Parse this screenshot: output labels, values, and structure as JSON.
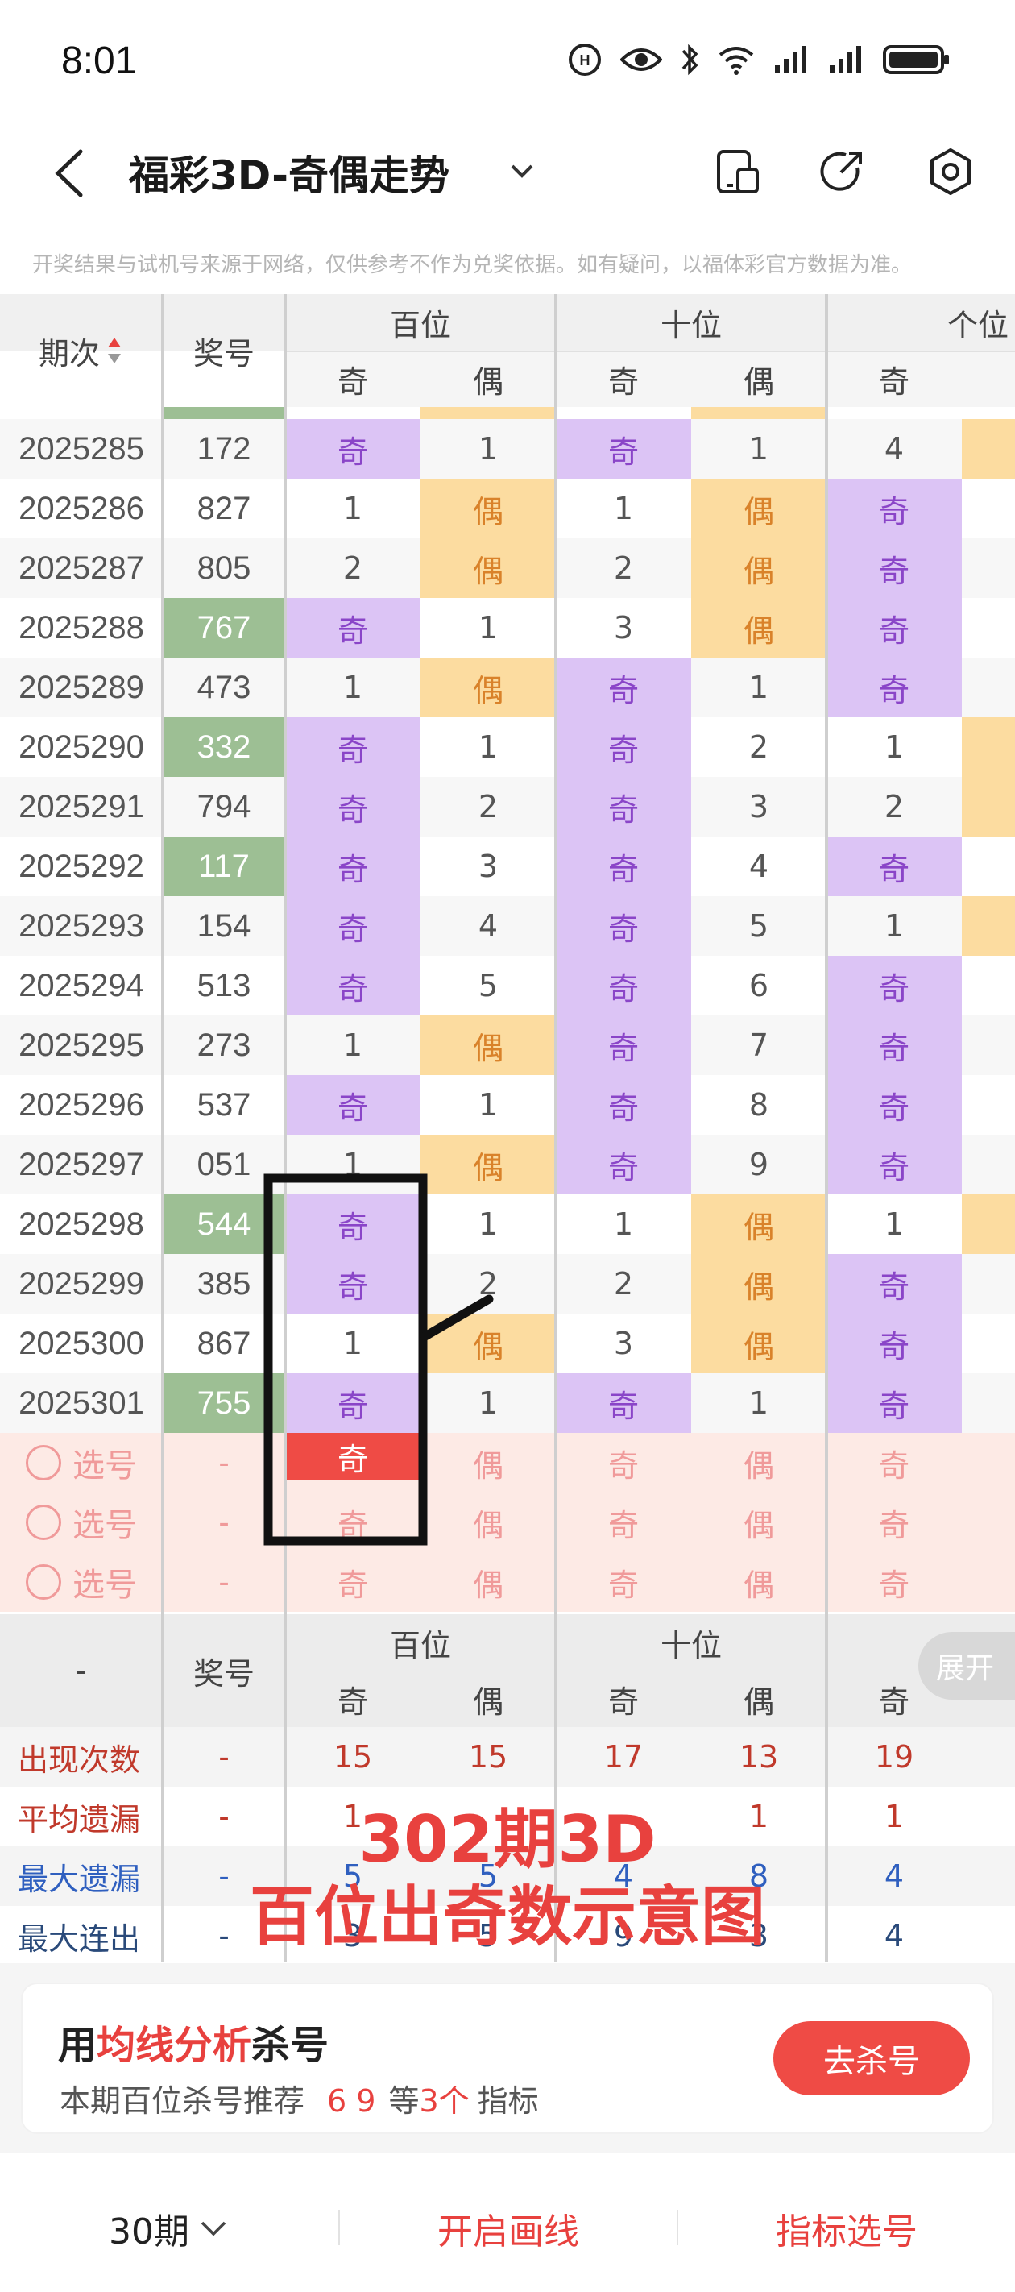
{
  "status": {
    "time": "8:01"
  },
  "header": {
    "title": "福彩3D-奇偶走势"
  },
  "notice": "开奖结果与试机号来源于网络，仅供参考不作为兑奖依据。如有疑问，以福体彩官方数据为准。",
  "table": {
    "period_header": "期次",
    "number_header": "奖号",
    "groups": [
      "百位",
      "十位",
      "个位"
    ],
    "sub": [
      "奇",
      "偶",
      "奇",
      "偶",
      "奇"
    ],
    "rows": [
      {
        "period": "2025285",
        "num": "172",
        "green": false,
        "b1": "奇",
        "b2": "1",
        "s1": "奇",
        "s2": "1",
        "g1": "4",
        "g2": "even"
      },
      {
        "period": "2025286",
        "num": "827",
        "green": false,
        "b1": "1",
        "b2": "偶",
        "s1": "1",
        "s2": "偶",
        "g1": "奇",
        "g2": ""
      },
      {
        "period": "2025287",
        "num": "805",
        "green": false,
        "b1": "2",
        "b2": "偶",
        "s1": "2",
        "s2": "偶",
        "g1": "奇",
        "g2": ""
      },
      {
        "period": "2025288",
        "num": "767",
        "green": true,
        "b1": "奇",
        "b2": "1",
        "s1": "3",
        "s2": "偶",
        "g1": "奇",
        "g2": ""
      },
      {
        "period": "2025289",
        "num": "473",
        "green": false,
        "b1": "1",
        "b2": "偶",
        "s1": "奇",
        "s2": "1",
        "g1": "奇",
        "g2": ""
      },
      {
        "period": "2025290",
        "num": "332",
        "green": true,
        "b1": "奇",
        "b2": "1",
        "s1": "奇",
        "s2": "2",
        "g1": "1",
        "g2": "even"
      },
      {
        "period": "2025291",
        "num": "794",
        "green": false,
        "b1": "奇",
        "b2": "2",
        "s1": "奇",
        "s2": "3",
        "g1": "2",
        "g2": "even"
      },
      {
        "period": "2025292",
        "num": "117",
        "green": true,
        "b1": "奇",
        "b2": "3",
        "s1": "奇",
        "s2": "4",
        "g1": "奇",
        "g2": ""
      },
      {
        "period": "2025293",
        "num": "154",
        "green": false,
        "b1": "奇",
        "b2": "4",
        "s1": "奇",
        "s2": "5",
        "g1": "1",
        "g2": "even"
      },
      {
        "period": "2025294",
        "num": "513",
        "green": false,
        "b1": "奇",
        "b2": "5",
        "s1": "奇",
        "s2": "6",
        "g1": "奇",
        "g2": ""
      },
      {
        "period": "2025295",
        "num": "273",
        "green": false,
        "b1": "1",
        "b2": "偶",
        "s1": "奇",
        "s2": "7",
        "g1": "奇",
        "g2": ""
      },
      {
        "period": "2025296",
        "num": "537",
        "green": false,
        "b1": "奇",
        "b2": "1",
        "s1": "奇",
        "s2": "8",
        "g1": "奇",
        "g2": ""
      },
      {
        "period": "2025297",
        "num": "051",
        "green": false,
        "b1": "1",
        "b2": "偶",
        "s1": "奇",
        "s2": "9",
        "g1": "奇",
        "g2": ""
      },
      {
        "period": "2025298",
        "num": "544",
        "green": true,
        "b1": "奇",
        "b2": "1",
        "s1": "1",
        "s2": "偶",
        "g1": "1",
        "g2": "even"
      },
      {
        "period": "2025299",
        "num": "385",
        "green": false,
        "b1": "奇",
        "b2": "2",
        "s1": "2",
        "s2": "偶",
        "g1": "奇",
        "g2": ""
      },
      {
        "period": "2025300",
        "num": "867",
        "green": false,
        "b1": "1",
        "b2": "偶",
        "s1": "3",
        "s2": "偶",
        "g1": "奇",
        "g2": ""
      },
      {
        "period": "2025301",
        "num": "755",
        "green": true,
        "b1": "奇",
        "b2": "1",
        "s1": "奇",
        "s2": "1",
        "g1": "奇",
        "g2": ""
      }
    ],
    "pick_rows": [
      {
        "label": "选号",
        "num": "-",
        "b1": "奇",
        "b2": "偶",
        "s1": "奇",
        "s2": "偶",
        "g1": "奇",
        "selected": true
      },
      {
        "label": "选号",
        "num": "-",
        "b1": "奇",
        "b2": "偶",
        "s1": "奇",
        "s2": "偶",
        "g1": "奇",
        "selected": false
      },
      {
        "label": "选号",
        "num": "-",
        "b1": "奇",
        "b2": "偶",
        "s1": "奇",
        "s2": "偶",
        "g1": "奇",
        "selected": false
      }
    ]
  },
  "stats": {
    "dash": "-",
    "number_header": "奖号",
    "groups": [
      "百位",
      "十位",
      "个位"
    ],
    "sub": [
      "奇",
      "偶",
      "奇",
      "偶",
      "奇"
    ],
    "expand_label": "展开",
    "rows": [
      {
        "label": "出现次数",
        "color": "#c0392b",
        "num": "-",
        "vals": [
          "15",
          "15",
          "17",
          "13",
          "19"
        ]
      },
      {
        "label": "平均遗漏",
        "color": "#c0392b",
        "num": "-",
        "vals": [
          "1",
          "",
          "",
          "1",
          "1"
        ]
      },
      {
        "label": "最大遗漏",
        "color": "#2f5fbf",
        "num": "-",
        "vals": [
          "5",
          "5",
          "4",
          "8",
          "4"
        ]
      },
      {
        "label": "最大连出",
        "color": "#2a4a7a",
        "num": "-",
        "vals": [
          "3",
          "5",
          "9",
          "3",
          "4"
        ]
      }
    ]
  },
  "overlay": {
    "line1": "302期3D",
    "line2": "百位出奇数示意图"
  },
  "promo": {
    "title_pre": "用",
    "title_hl": "均线分析",
    "title_post": "杀号",
    "sub_pre": "本期百位杀号推荐",
    "sub_nums": "6 9",
    "sub_mid": "等",
    "sub_count": "3个",
    "sub_post": "指标",
    "button": "去杀号"
  },
  "bottom": {
    "periods": "30期",
    "draw_line": "开启画线",
    "indicator": "指标选号"
  },
  "colors": {
    "odd": "#dcc4f5",
    "even": "#fcdca0",
    "green": "#9dbf94",
    "accent": "#ef4b45"
  }
}
